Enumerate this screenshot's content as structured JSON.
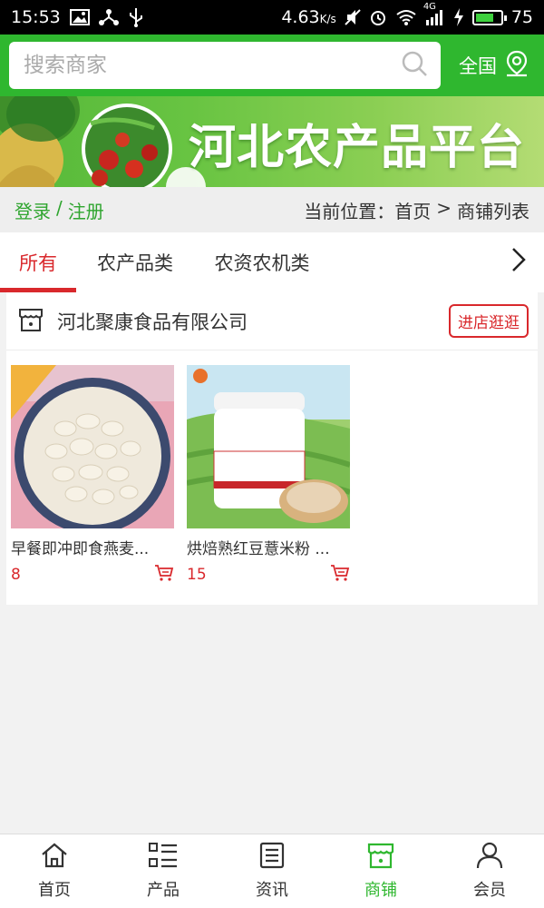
{
  "status_bar": {
    "time": "15:53",
    "speed": "4.63",
    "speed_unit": "K/s",
    "network": "4G",
    "battery": "75",
    "battery_fraction": 0.75
  },
  "header": {
    "search_placeholder": "搜索商家",
    "region_label": "全国"
  },
  "banner": {
    "title": "河北农产品平台"
  },
  "location_bar": {
    "login": "登录",
    "separator": "/",
    "register": "注册",
    "prefix": "当前位置：",
    "home": "首页",
    "arrow": ">",
    "current": "商铺列表"
  },
  "tabs": [
    {
      "label": "所有",
      "active": true
    },
    {
      "label": "农产品类",
      "active": false
    },
    {
      "label": "农资农机类",
      "active": false
    }
  ],
  "store": {
    "name": "河北聚康食品有限公司",
    "visit_button": "进店逛逛",
    "products": [
      {
        "name": "早餐即冲即食燕麦...",
        "price": "8"
      },
      {
        "name": "烘焙熟红豆薏米粉 ...",
        "price": "15"
      }
    ]
  },
  "bottom_nav": [
    {
      "label": "首页",
      "icon": "home-icon",
      "active": false
    },
    {
      "label": "产品",
      "icon": "list-icon",
      "active": false
    },
    {
      "label": "资讯",
      "icon": "news-icon",
      "active": false
    },
    {
      "label": "商铺",
      "icon": "store-icon",
      "active": true
    },
    {
      "label": "会员",
      "icon": "user-icon",
      "active": false
    }
  ],
  "colors": {
    "brand_green": "#2fb72f",
    "accent_red": "#d9282c"
  }
}
